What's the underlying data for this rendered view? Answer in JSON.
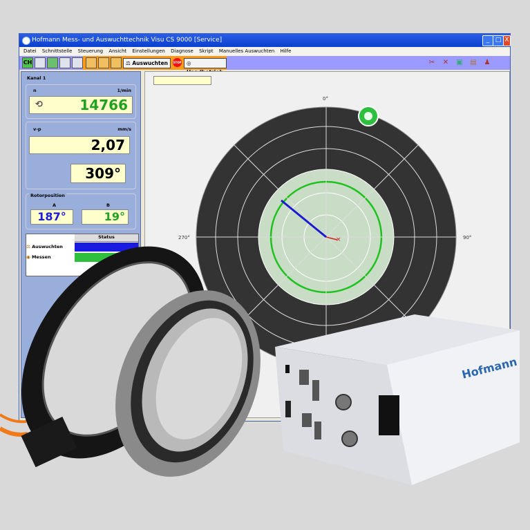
{
  "window": {
    "title": "Hofmann Mess- und Auswuchttechnik Visu CS 9000 [Service]",
    "controls": [
      "_",
      "□",
      "X"
    ]
  },
  "menu": [
    "Datei",
    "Schnittstelle",
    "Steuerung",
    "Ansicht",
    "Einstellungen",
    "Diagnose",
    "Skript",
    "Manuelles Auswuchten",
    "Hilfe"
  ],
  "toolbar": {
    "ch_label": "CH",
    "auswuchten_label": "Auswuchten",
    "stop_label": "STOP",
    "handbetrieb_label": "Handbetrieb"
  },
  "kanal": {
    "title": "Kanal 1",
    "speed": {
      "label": "n",
      "unit": "1/min",
      "value": "14766"
    },
    "vib": {
      "label": "v-p",
      "unit": "mm/s",
      "value": "2,07",
      "angle": "309°"
    }
  },
  "rotorposition": {
    "title": "Rotorposition",
    "a_label": "A",
    "a_value": "187°",
    "b_label": "B",
    "b_value": "19°"
  },
  "status_table": {
    "header": "Status",
    "rows": [
      "Auswuchten",
      "Messen"
    ]
  },
  "polar": {
    "top_label": "0°",
    "left_label": "270°",
    "right_label": "90°",
    "vector_angle_deg": 309,
    "vector_magnitude_fraction": 0.55
  },
  "device": {
    "brand": "Hofmann"
  },
  "colors": {
    "value_green": "#21a121",
    "value_blue": "#1a1ae0",
    "polar_dark": "#333333",
    "polar_light": "#c9dcc5"
  }
}
